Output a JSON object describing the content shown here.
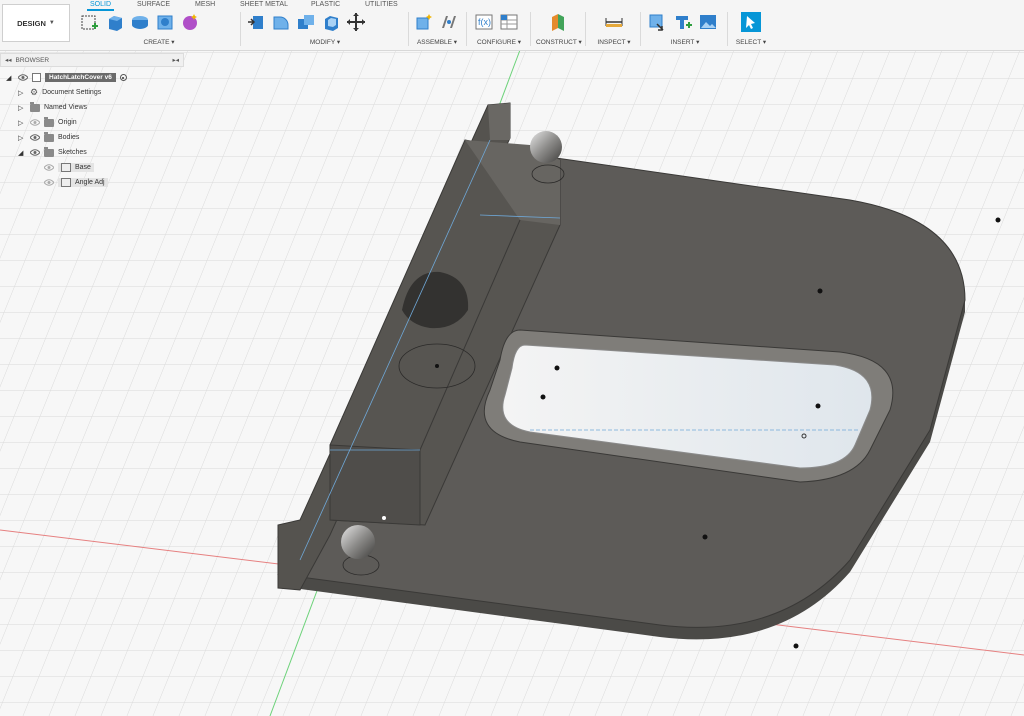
{
  "toolbar": {
    "workspace": "DESIGN",
    "tabs": [
      {
        "label": "SOLID",
        "active": true
      },
      {
        "label": "SURFACE",
        "active": false
      },
      {
        "label": "MESH",
        "active": false
      },
      {
        "label": "SHEET METAL",
        "active": false
      },
      {
        "label": "PLASTIC",
        "active": false
      },
      {
        "label": "UTILITIES",
        "active": false
      }
    ],
    "groups": [
      {
        "label": "CREATE",
        "icons": [
          "create-sketch-icon",
          "extrude-icon",
          "revolve-icon",
          "hole-icon",
          "form-icon"
        ]
      },
      {
        "label": "MODIFY",
        "icons": [
          "press-pull-icon",
          "fillet-icon",
          "combine-icon",
          "shell-icon",
          "move-icon"
        ]
      },
      {
        "label": "ASSEMBLE",
        "icons": [
          "new-component-icon",
          "joint-icon"
        ]
      },
      {
        "label": "CONFIGURE",
        "icons": [
          "parameters-icon",
          "configure-table-icon"
        ]
      },
      {
        "label": "CONSTRUCT",
        "icons": [
          "offset-plane-icon"
        ]
      },
      {
        "label": "INSPECT",
        "icons": [
          "measure-icon"
        ]
      },
      {
        "label": "INSERT",
        "icons": [
          "insert-derive-icon",
          "insert-mesh-icon",
          "insert-image-icon"
        ]
      },
      {
        "label": "SELECT",
        "icons": [
          "select-icon"
        ]
      }
    ]
  },
  "browser": {
    "title": "BROWSER",
    "document": "HatchLatchCover v6",
    "items": [
      {
        "label": "Document Settings"
      },
      {
        "label": "Named Views"
      },
      {
        "label": "Origin"
      },
      {
        "label": "Bodies"
      },
      {
        "label": "Sketches"
      }
    ],
    "sketches": [
      {
        "label": "Base"
      },
      {
        "label": "Angle Adj"
      }
    ]
  },
  "colors": {
    "accent": "#0696d7",
    "body_top": "#5d5b58",
    "body_side": "#4b4a47",
    "grid": "#d9d9d9",
    "background": "#f7f7f7"
  }
}
